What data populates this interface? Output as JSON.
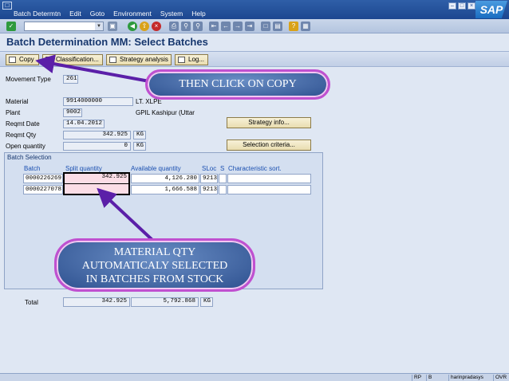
{
  "menu": {
    "items": [
      "Batch Determtn",
      "Edit",
      "Goto",
      "Environment",
      "System",
      "Help"
    ]
  },
  "logo": "SAP",
  "screen_title": "Batch Determination MM: Select Batches",
  "app_toolbar": {
    "copy": "Copy",
    "classification": "Classification...",
    "strategy_analysis": "Strategy analysis",
    "log": "Log..."
  },
  "form": {
    "movement_type_label": "Movement Type",
    "movement_type": "261",
    "material_label": "Material",
    "material": "9914000000",
    "material_desc": "LT. XLPE",
    "plant_label": "Plant",
    "plant": "9002",
    "plant_desc": "GPIL Kashipur (Uttar",
    "reqmt_date_label": "Reqmt Date",
    "reqmt_date": "14.04.2012",
    "reqmt_qty_label": "Reqmt Qty",
    "reqmt_qty": "342.925",
    "reqmt_qty_unit": "KG",
    "open_qty_label": "Open quantity",
    "open_qty": "0",
    "open_qty_unit": "KG",
    "strategy_info": "Strategy info...",
    "selection_criteria": "Selection criteria..."
  },
  "batch_selection": {
    "title": "Batch Selection",
    "columns": [
      "Batch",
      "Split quantity",
      "Available quantity",
      "SLoc",
      "S",
      "Characteristic sort."
    ],
    "rows": [
      {
        "batch": "0000226269",
        "split": "342.925",
        "available": "4,126.280",
        "sloc": "9213"
      },
      {
        "batch": "0000227078",
        "split": "",
        "available": "1,666.588",
        "sloc": "9213"
      }
    ]
  },
  "total": {
    "label": "Total",
    "split": "342.925",
    "available": "5,792.868",
    "unit": "KG"
  },
  "status_bar": {
    "system": "RP",
    "client_short": "B",
    "user": "harinpradasys",
    "mode": "OVR"
  },
  "callouts": {
    "copy_hint": "THEN CLICK ON COPY",
    "qty_hint": [
      "MATERIAL QTY",
      "AUTOMATICALY SELECTED",
      "IN  BATCHES FROM STOCK"
    ]
  },
  "colors": {
    "accent": "#c050d0",
    "title_blue": "#17376e",
    "callout_fill": "#3a5c9e"
  }
}
